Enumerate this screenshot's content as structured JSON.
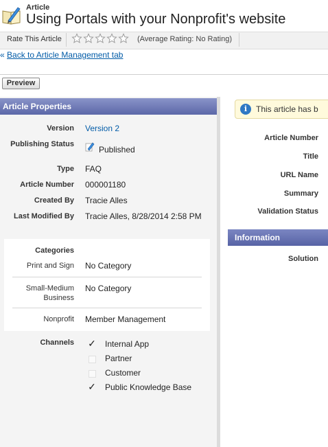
{
  "header": {
    "kicker": "Article",
    "title": "Using Portals with your Nonprofit's website"
  },
  "rating": {
    "label": "Rate This Article",
    "star_count": 5,
    "stars_filled": 0,
    "average": "(Average Rating: No Rating)"
  },
  "back_link": {
    "prefix": "«",
    "label": "Back to Article Management tab"
  },
  "preview_button": "Preview",
  "properties": {
    "header": "Article Properties",
    "fields": [
      {
        "label": "Version",
        "value": "Version 2"
      },
      {
        "label": "Publishing Status",
        "value": "Published"
      },
      {
        "label": "Type",
        "value": "FAQ"
      },
      {
        "label": "Article Number",
        "value": "000001180"
      },
      {
        "label": "Created By",
        "value": "Tracie Alles"
      },
      {
        "label": "Last Modified By",
        "value": "Tracie Alles, 8/28/2014 2:58 PM"
      }
    ],
    "categories": {
      "header": "Categories",
      "rows": [
        {
          "label": "Print and Sign",
          "value": "No Category"
        },
        {
          "label": "Small-Medium Business",
          "value": "No Category"
        },
        {
          "label": "Nonprofit",
          "value": "Member Management"
        }
      ]
    },
    "channels": {
      "label": "Channels",
      "items": [
        {
          "name": "Internal App",
          "checked": true
        },
        {
          "name": "Partner",
          "checked": false
        },
        {
          "name": "Customer",
          "checked": false
        },
        {
          "name": "Public Knowledge Base",
          "checked": true
        }
      ]
    }
  },
  "detail": {
    "info_message": "This article has b",
    "fields": [
      "Article Number",
      "Title",
      "URL Name",
      "Summary",
      "Validation Status"
    ],
    "information_header": "Information",
    "information_fields": [
      "Solution"
    ]
  },
  "colors": {
    "link": "#015ba7",
    "section_header": "#5b67a8",
    "info_bg": "#fffadc"
  }
}
